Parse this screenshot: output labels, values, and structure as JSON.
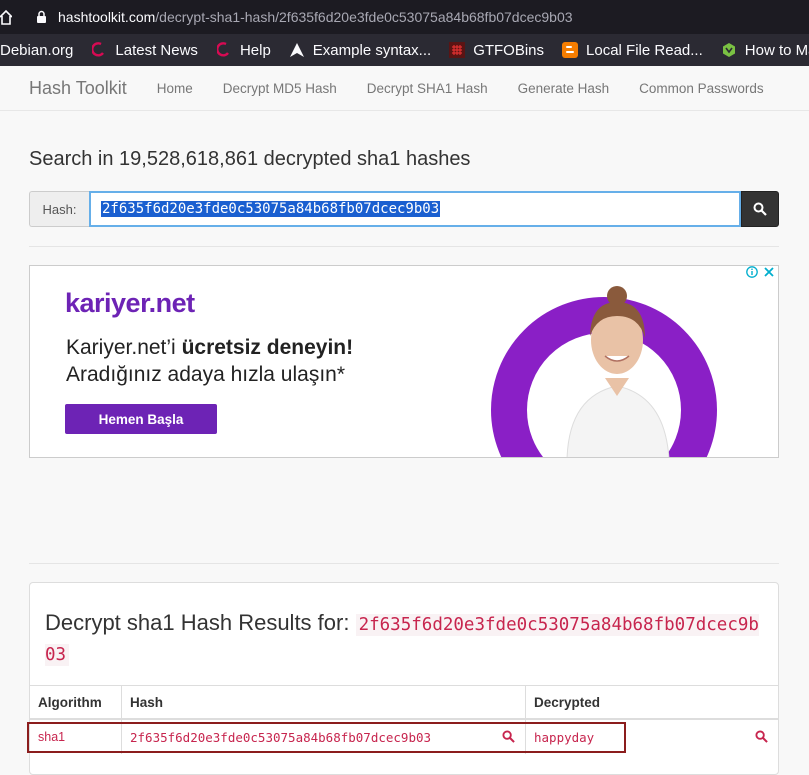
{
  "browser": {
    "url_domain": "hashtoolkit.com",
    "url_path": "/decrypt-sha1-hash/2f635f6d20e3fde0c53075a84b68fb07dcec9b03",
    "bookmarks": [
      {
        "label": "Debian.org",
        "icon": "debian-icon"
      },
      {
        "label": "Latest News",
        "icon": "swirl-icon"
      },
      {
        "label": "Help",
        "icon": "swirl-icon"
      },
      {
        "label": "Example syntax...",
        "icon": "arch-icon"
      },
      {
        "label": "GTFOBins",
        "icon": "grid-icon"
      },
      {
        "label": "Local File Read...",
        "icon": "blogger-icon"
      },
      {
        "label": "How to Man",
        "icon": "hexagon-icon"
      }
    ]
  },
  "navbar": {
    "brand": "Hash Toolkit",
    "links": [
      "Home",
      "Decrypt MD5 Hash",
      "Decrypt SHA1 Hash",
      "Generate Hash",
      "Common Passwords"
    ]
  },
  "search": {
    "title": "Search in 19,528,618,861 decrypted sha1 hashes",
    "addon_label": "Hash:",
    "value": "2f635f6d20e3fde0c53075a84b68fb07dcec9b03"
  },
  "ad": {
    "logo": "kariyer.net",
    "line1_pre": "Kariyer.net’i ",
    "line1_bold": "ücretsiz deneyin!",
    "line2": "Aradığınız adaya hızla ulaşın*",
    "cta": "Hemen Başla",
    "color": "#6d23b5"
  },
  "results": {
    "title_prefix": "Decrypt sha1 Hash Results for: ",
    "title_hash": "2f635f6d20e3fde0c53075a84b68fb07dcec9b03",
    "columns": [
      "Algorithm",
      "Hash",
      "Decrypted"
    ],
    "rows": [
      {
        "algorithm": "sha1",
        "hash": "2f635f6d20e3fde0c53075a84b68fb07dcec9b03",
        "decrypted": "happyday"
      }
    ]
  }
}
